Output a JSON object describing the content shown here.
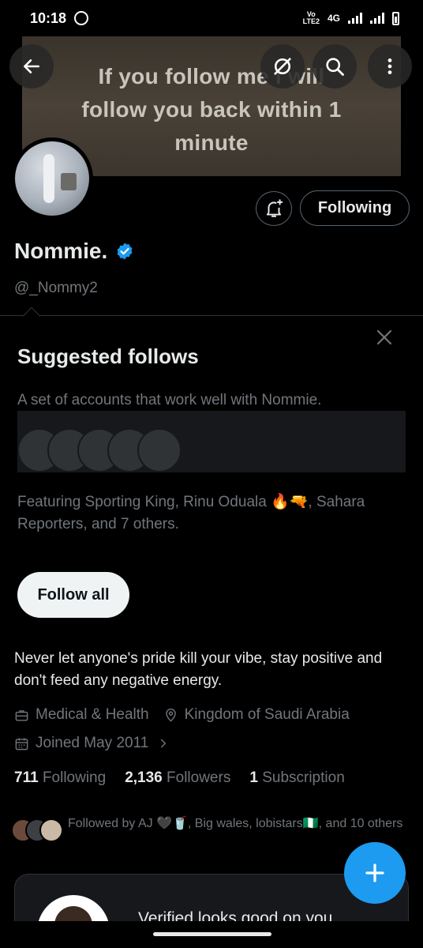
{
  "status_bar": {
    "time": "10:18",
    "volte_line1": "Vo",
    "volte_line2": "LTE2",
    "network": "4G"
  },
  "banner": {
    "line1": "If you follow me I will",
    "line2": "follow you back within 1",
    "line3": "minute"
  },
  "toolbar": {
    "back_icon": "arrow-left-icon",
    "grok_icon": "grok-icon",
    "search_icon": "search-icon",
    "more_icon": "more-vertical-icon"
  },
  "profile": {
    "display_name": "Nommie.",
    "handle": "@_Nommy2",
    "following_button": "Following",
    "verified_color": "#1d9bf0"
  },
  "suggested": {
    "title": "Suggested follows",
    "subtitle": "A set of accounts that work well with Nommie.",
    "featuring": "Featuring Sporting King, Rinu Oduala 🔥🔫, Sahara Reporters, and 7 others.",
    "follow_all": "Follow all"
  },
  "bio": "Never let anyone's pride kill your vibe, stay positive and don't feed any negative energy.",
  "meta": {
    "category": "Medical & Health",
    "location": "Kingdom of Saudi Arabia",
    "joined": "Joined May 2011"
  },
  "stats": {
    "following_count": "711",
    "following_label": "Following",
    "followers_count": "2,136",
    "followers_label": "Followers",
    "subscriptions_count": "1",
    "subscriptions_label": "Subscription"
  },
  "followed_by": "Followed by AJ 🖤🥤, Big wales, lobistars🇳🇬, and 10 others",
  "promo": {
    "text": "Verified looks good on you"
  },
  "colors": {
    "accent": "#1d9bf0",
    "background": "#000000",
    "secondary_text": "#71767b"
  }
}
